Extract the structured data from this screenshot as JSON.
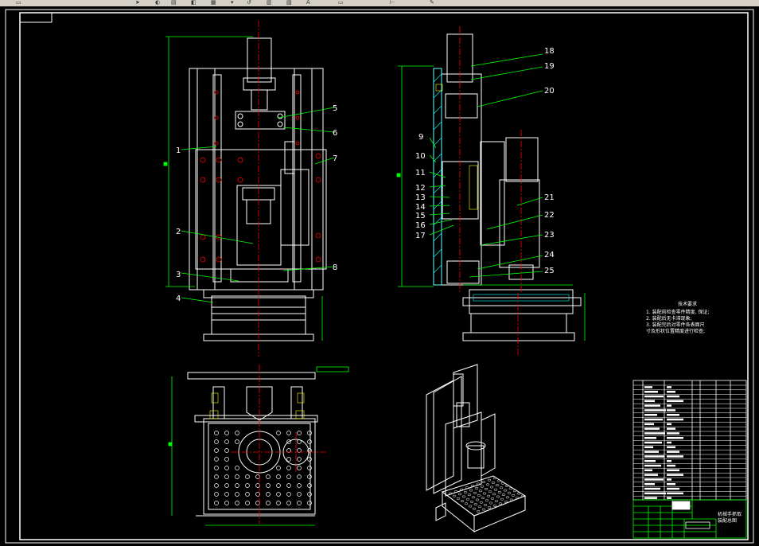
{
  "toolbar": {
    "icons": [
      "arrow-icon",
      "select-icon",
      "layer-icon",
      "properties-icon",
      "match-icon",
      "dropdown-icon",
      "refresh-icon",
      "table-icon",
      "chart-icon",
      "undo-icon",
      "text-icon",
      "line-icon",
      "measure-icon",
      "brush-icon"
    ]
  },
  "colors": {
    "background": "#000000",
    "outline": "#ffffff",
    "centerline": "#ff0000",
    "dimension": "#00ff00",
    "leader": "#00ff00",
    "hatch": "#00ffff",
    "titleblock": "#ffffff"
  },
  "part_labels": {
    "front_view": [
      "1",
      "2",
      "3",
      "4",
      "5",
      "6",
      "7",
      "8"
    ],
    "side_view": [
      "9",
      "10",
      "11",
      "12",
      "13",
      "14",
      "15",
      "16",
      "17",
      "18",
      "19",
      "20",
      "21",
      "22",
      "23",
      "24",
      "25"
    ]
  },
  "tech_notes": {
    "title": "技术要求",
    "lines": [
      "1. 装配前检查零件精度, 保证;",
      "2. 装配后无卡滞现象;",
      "3. 装配完后对零件各表面尺",
      "寸及形状位置精度进行检查;"
    ]
  },
  "titleblock": {
    "drawing_name_1": "机械手抓取",
    "drawing_name_2": "装配总图"
  }
}
